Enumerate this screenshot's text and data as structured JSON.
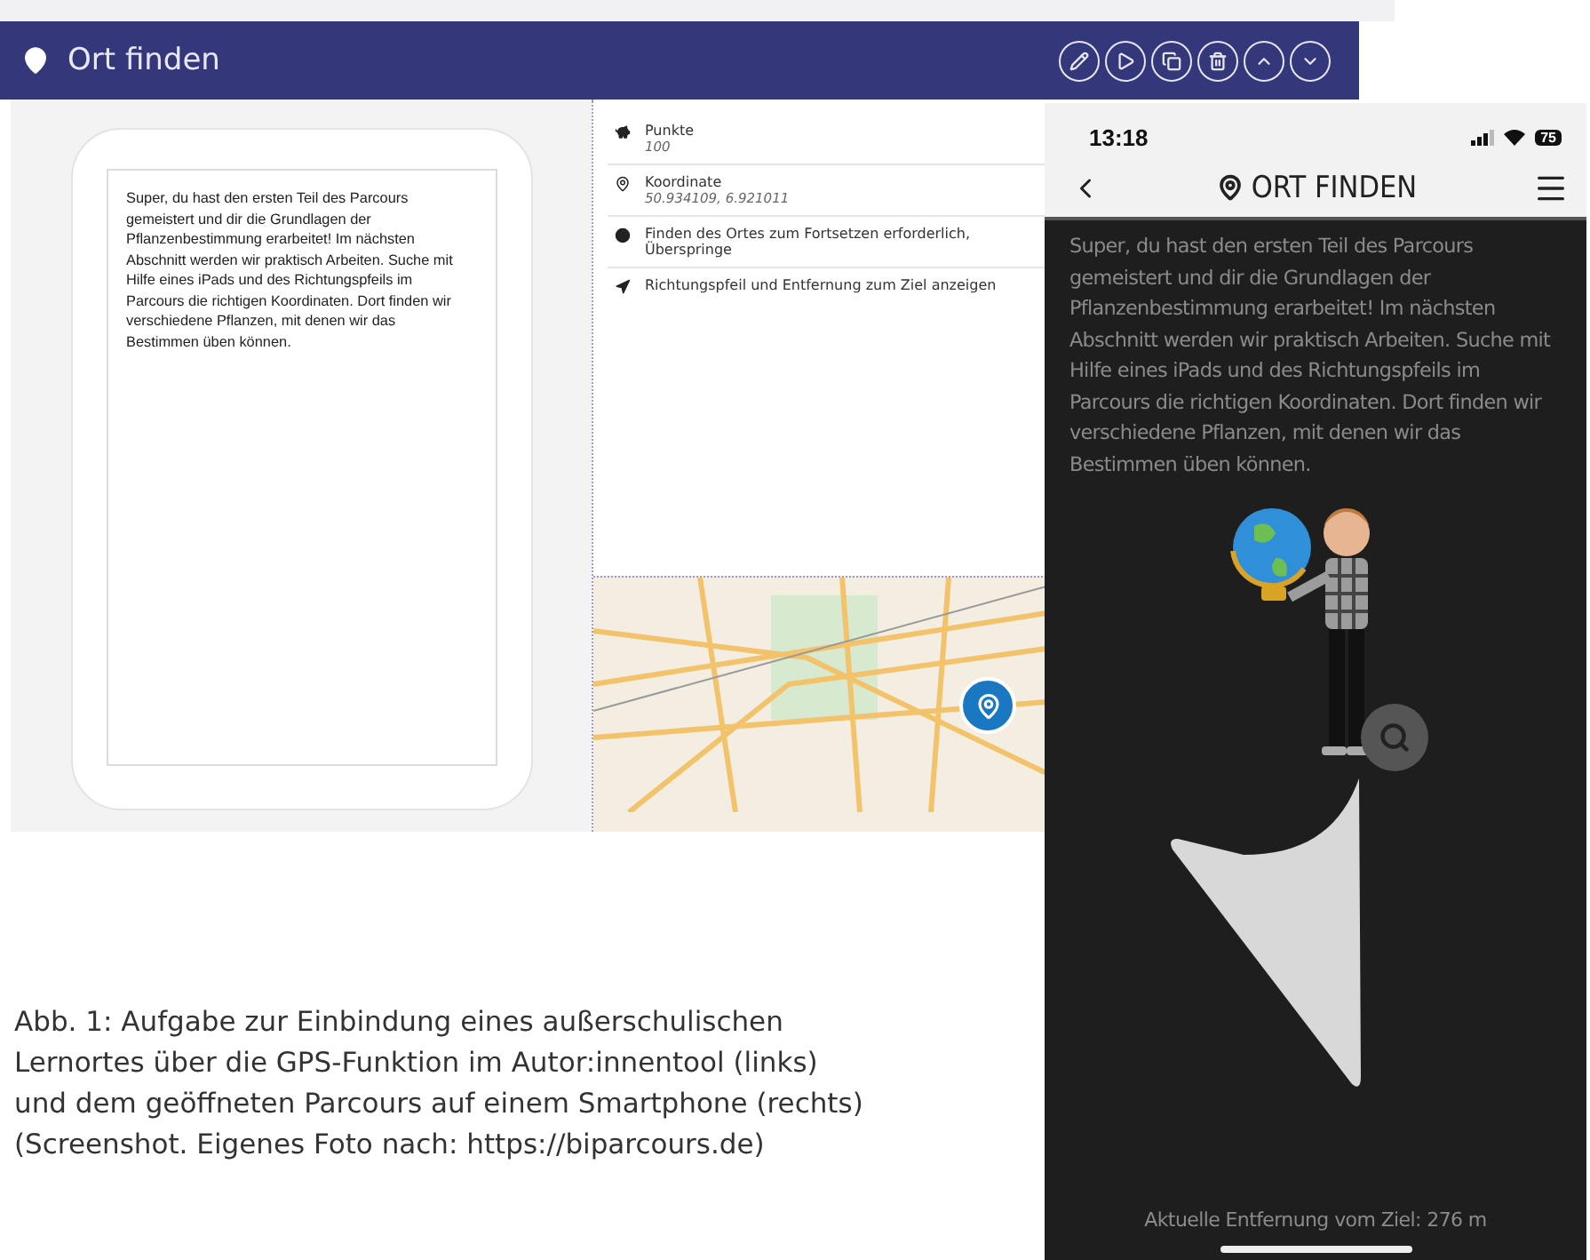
{
  "editor": {
    "title": "Ort finden",
    "preview_text": "Super, du hast den ersten Teil des Parcours gemeistert und dir die Grundlagen der Pflanzenbestimmung erarbeitet! Im nächsten Abschnitt werden wir praktisch Arbeiten. Suche mit Hilfe eines iPads und des Richtungspfeils im Parcours die richtigen Koordinaten. Dort finden wir verschiedene Pflanzen, mit denen wir das Bestimmen üben können.",
    "properties": [
      {
        "kind": "field",
        "label": "Punkte",
        "value": "100"
      },
      {
        "kind": "field",
        "label": "Koordinate",
        "value": "50.934109, 6.921011"
      },
      {
        "kind": "note",
        "label": "Finden des Ortes zum Fortsetzen erforderlich, Überspringe"
      },
      {
        "kind": "note",
        "label": "Richtungspfeil und Entfernung zum Ziel anzeigen"
      }
    ]
  },
  "phone": {
    "time": "13:18",
    "battery": "75",
    "title": "ORT FINDEN",
    "description": "Super, du hast den ersten Teil des Parcours gemeistert und dir die Grundlagen der Pflanzenbestimmung erarbeitet! Im nächsten Abschnitt werden wir praktisch Arbeiten. Suche mit Hilfe eines iPads und des Richtungspfeils im Parcours die richtigen Koordinaten. Dort finden wir verschiedene Pflanzen, mit denen wir das Bestimmen üben können.",
    "distance": "Aktuelle Entfernung vom Ziel: 276 m"
  },
  "caption": {
    "lines": [
      "Abb. 1: Aufgabe zur Einbindung eines außerschulischen",
      "Lernortes über die GPS-Funktion im Autor:innentool (links)",
      "und dem geöffneten Parcours auf einem Smartphone (rechts)",
      "(Screenshot. Eigenes Foto nach: https://biparcours.de)"
    ]
  }
}
